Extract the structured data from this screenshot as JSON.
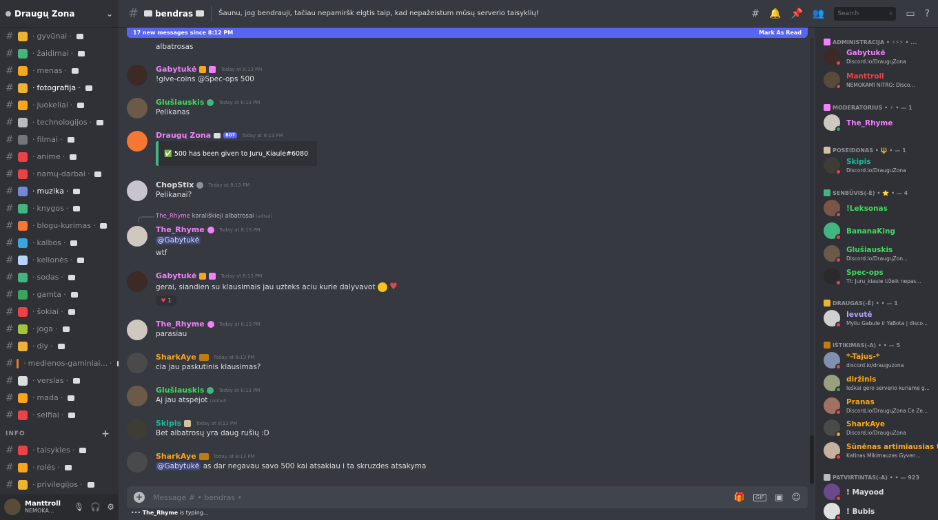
{
  "server": {
    "name": "Draugų Zona"
  },
  "channels": [
    {
      "name": "gyvūnai",
      "emoji_color": "#f0b232"
    },
    {
      "name": "žaidimai",
      "emoji_color": "#43b581"
    },
    {
      "name": "menas",
      "emoji_color": "#faa61a"
    },
    {
      "name": "fotografija",
      "emoji_color": "#f0b232",
      "active": true
    },
    {
      "name": "juokeliai",
      "emoji_color": "#faa61a"
    },
    {
      "name": "technologijos",
      "emoji_color": "#b9bbbe"
    },
    {
      "name": "filmai",
      "emoji_color": "#72767d"
    },
    {
      "name": "anime",
      "emoji_color": "#ed4245"
    },
    {
      "name": "namų-darbai",
      "emoji_color": "#ed4245"
    },
    {
      "name": "muzika",
      "emoji_color": "#7289da",
      "active": true
    },
    {
      "name": "knygos",
      "emoji_color": "#43b581"
    },
    {
      "name": "blogu-kurimas",
      "emoji_color": "#f57731"
    },
    {
      "name": "kalbos",
      "emoji_color": "#3ba5e0"
    },
    {
      "name": "kelionės",
      "emoji_color": "#b9d5ff"
    },
    {
      "name": "sodas",
      "emoji_color": "#43b581"
    },
    {
      "name": "gamta",
      "emoji_color": "#3ba55d"
    },
    {
      "name": "šokiai",
      "emoji_color": "#ed4245"
    },
    {
      "name": "joga",
      "emoji_color": "#a3c53c"
    },
    {
      "name": "diy",
      "emoji_color": "#f0b232"
    },
    {
      "name": "medienos-gaminiai...",
      "emoji_color": "#e67e22"
    },
    {
      "name": "verslas",
      "emoji_color": "#dcddde"
    },
    {
      "name": "mada",
      "emoji_color": "#faa61a"
    },
    {
      "name": "selfiai",
      "emoji_color": "#ed4245"
    }
  ],
  "info_category": {
    "label": "INFO"
  },
  "info_channels": [
    {
      "name": "taisykles",
      "emoji_color": "#ed4245"
    },
    {
      "name": "rolės",
      "emoji_color": "#faa61a"
    },
    {
      "name": "privilegijos",
      "emoji_color": "#f0b232"
    }
  ],
  "user_panel": {
    "name": "Manttroll",
    "status": "NEMOKA..."
  },
  "topbar": {
    "channel": "bendras",
    "topic": "Šaunu, jog bendrauji, tačiau nepamiršk elgtis taip, kad nepažeistum mūsų serverio taisyklių!",
    "search_placeholder": "Search"
  },
  "banner": {
    "text": "17 new messages since 8:12 PM",
    "action": "Mark As Read"
  },
  "messages": [
    {
      "lines": [
        "albatrosas"
      ]
    },
    {
      "author": "Gabytukė",
      "color": "#f47fff",
      "time": "Today at 8:13 PM",
      "lines": [
        "!give-coins @Spec-ops  500"
      ]
    },
    {
      "author": "Glušiauskis",
      "color": "#43d75e",
      "time": "Today at 8:13 PM",
      "lines": [
        "Pelikanas"
      ]
    },
    {
      "author": "Draugų Zona",
      "color": "#f47fff",
      "time": "Today at 8:13 PM",
      "bot": "BOT",
      "embed": "✅ 500  has been given to Juru_Kiaule#6080"
    },
    {
      "author": "ChopStix",
      "color": "#dcddde",
      "time": "Today at 8:13 PM",
      "lines": [
        "Pelikanai?"
      ]
    },
    {
      "reply_author": "The_Rhyme",
      "reply_text": "karališkieji albatrosai",
      "reply_edited": "(edited)",
      "author": "The_Rhyme",
      "color": "#f47fff",
      "time": "Today at 8:13 PM",
      "mention": "@Gabytukė",
      "lines": [
        "wtf"
      ]
    },
    {
      "author": "Gabytukė",
      "color": "#f47fff",
      "time": "Today at 8:13 PM",
      "lines": [
        "gerai, siandien su klausimais jau uzteks  aciu kurie dalyvavot "
      ],
      "reaction_count": "1"
    },
    {
      "author": "The_Rhyme",
      "color": "#f47fff",
      "time": "Today at 8:13 PM",
      "lines": [
        "parasiau"
      ]
    },
    {
      "author": "SharkAye",
      "color": "#faa61a",
      "time": "Today at 8:13 PM",
      "lines": [
        "cia jau paskutinis klausimas?"
      ]
    },
    {
      "author": "Glušiauskis",
      "color": "#43d75e",
      "time": "Today at 8:13 PM",
      "lines": [
        "Aj jau  atspėjot"
      ],
      "edited": "(edited)"
    },
    {
      "author": "Skipis",
      "color": "#1abc9c",
      "time": "Today at 8:13 PM",
      "lines": [
        "Bet albatrosų yra daug rušių :D"
      ]
    },
    {
      "author": "SharkAye",
      "color": "#faa61a",
      "time": "Today at 8:13 PM",
      "mention": "@Gabytukė",
      "lines": [
        " as dar negavau savo 500 kai atsakiau i ta skruzdes atsakyma"
      ]
    }
  ],
  "composer": {
    "placeholder": "Message #  • bendras • "
  },
  "typing": {
    "user": "The_Rhyme",
    "text": " is typing..."
  },
  "members": {
    "categories": [
      {
        "label": "ADMINISTRACIJA • ⚡⚡⚡ • ..."
      },
      {
        "label": "MODERATORIUS • ⚡ • — 1"
      },
      {
        "label": "POSEIDONAS • 🔱 • — 1"
      },
      {
        "label": "SENBŪVIS(-Ė) • ⭐ • — 4"
      },
      {
        "label": "DRAUGAS(-Ė) • • — 1"
      },
      {
        "label": "IŠTIKIMAS(-A) • • — 5"
      },
      {
        "label": "PATVIRTINTAS(-A) • • — 923"
      }
    ],
    "list": [
      {
        "name": "Gabytukė",
        "color": "#f47fff",
        "sub": "Discord.io/DraugųZona",
        "status": "#ed4245"
      },
      {
        "name": "Manttroll",
        "color": "#ed4245",
        "sub": "NEMOKAMI NITRO: Disco...",
        "status": "#ed4245"
      },
      {
        "name": "The_Rhyme",
        "color": "#f47fff",
        "sub": "",
        "status": "#3ba55d"
      },
      {
        "name": "Skipis",
        "color": "#1abc9c",
        "sub": "Discord.io/DrauguZona",
        "status": "#ed4245"
      },
      {
        "name": "!Leksonas",
        "color": "#43d75e",
        "sub": "",
        "status": "#ed4245"
      },
      {
        "name": "BananaKing",
        "color": "#43d75e",
        "sub": "",
        "status": "#ed4245"
      },
      {
        "name": "Glušiauskis",
        "color": "#43d75e",
        "sub": "Discord.io/DraugųZon...",
        "status": "#ed4245"
      },
      {
        "name": "Spec-ops",
        "color": "#43d75e",
        "sub": "Tt: Juru_kiaule Užeik nepas...",
        "status": "#ed4245"
      },
      {
        "name": "Ievutė",
        "color": "#b9a2ff",
        "sub": "Myliu Gabule ir YaBota | disco...",
        "status": "#ed4245"
      },
      {
        "name": "*-Tajus-*",
        "color": "#faa61a",
        "sub": "discord.io/drauguzona",
        "status": "#ed4245"
      },
      {
        "name": "diržinis",
        "color": "#faa61a",
        "sub": "Ieškai gero serverio kuriame g...",
        "status": "#3ba55d"
      },
      {
        "name": "Pranas",
        "color": "#faa61a",
        "sub": "Discord.io/DraugųZona Ce Ze...",
        "status": "#ed4245"
      },
      {
        "name": "SharkAye",
        "color": "#faa61a",
        "sub": "Discord.io/DrauguZona",
        "status": "#faa61a"
      },
      {
        "name": "Sūnėnas artimiausias t...",
        "color": "#faa61a",
        "sub": "Katinas Mikimauzas Gyven...",
        "status": "#ed4245"
      },
      {
        "name": "! Mayood",
        "color": "#dcddde",
        "sub": "",
        "status": "#ed4245"
      },
      {
        "name": "! Bubis",
        "color": "#dcddde",
        "sub": "",
        "status": "#ed4245"
      }
    ]
  }
}
